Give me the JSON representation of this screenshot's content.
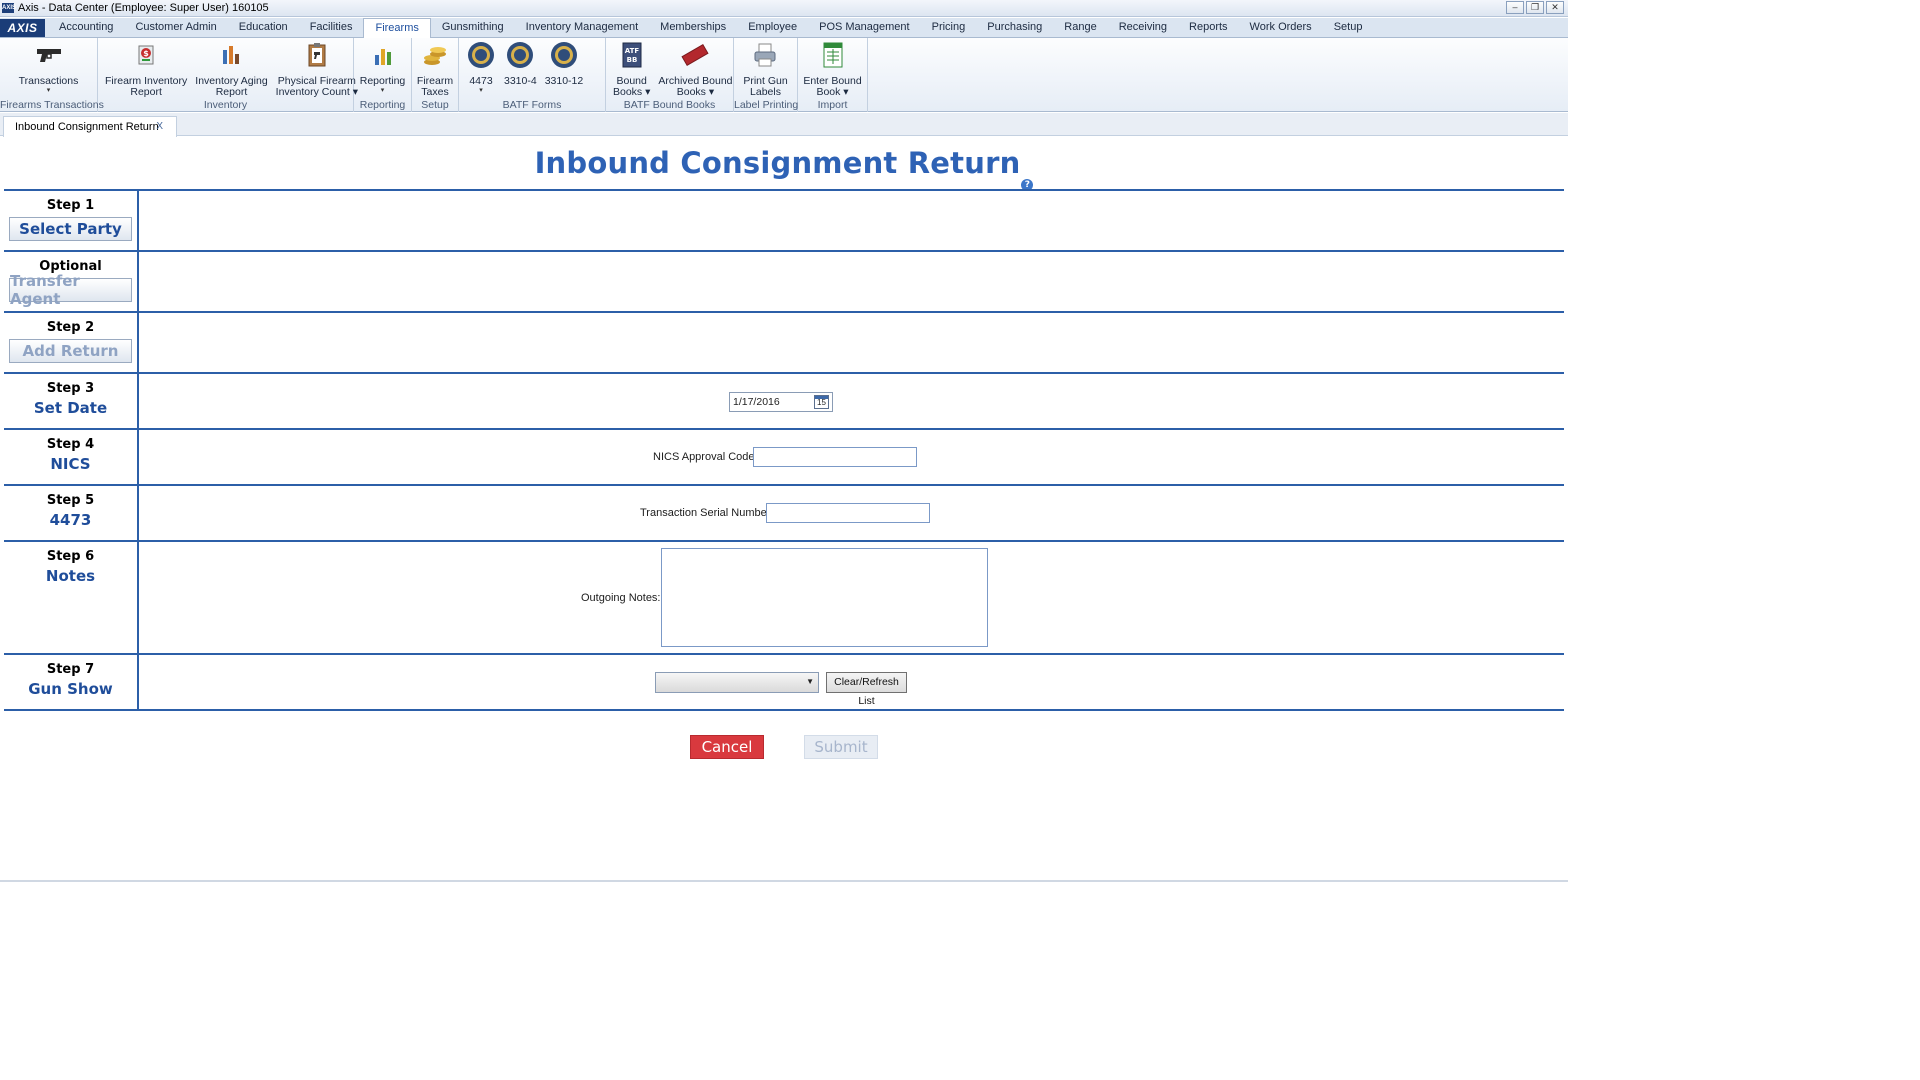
{
  "window": {
    "title": "Axis - Data Center  (Employee: Super User) 160105",
    "logo": "AXIS",
    "minimize": "–",
    "restore": "❐",
    "close": "✕"
  },
  "menu": {
    "logo": "AXIS",
    "tabs": [
      "Accounting",
      "Customer Admin",
      "Education",
      "Facilities",
      "Firearms",
      "Gunsmithing",
      "Inventory Management",
      "Memberships",
      "Employee",
      "POS Management",
      "Pricing",
      "Purchasing",
      "Range",
      "Receiving",
      "Reports",
      "Work Orders",
      "Setup"
    ],
    "active": "Firearms"
  },
  "ribbon": {
    "groups": [
      {
        "label": "Firearms Transactions",
        "buttons": [
          {
            "line1": "Transactions",
            "line2": "▾",
            "icon": "handgun-icon"
          }
        ]
      },
      {
        "label": "Inventory",
        "buttons": [
          {
            "line1": "Firearm Inventory",
            "line2": "Report",
            "icon": "inventory-report-icon"
          },
          {
            "line1": "Inventory Aging",
            "line2": "Report",
            "icon": "aging-report-icon"
          },
          {
            "line1": "Physical Firearm",
            "line2": "Inventory Count ▾",
            "icon": "clipboard-icon"
          }
        ]
      },
      {
        "label": "Reporting",
        "buttons": [
          {
            "line1": "Reporting",
            "line2": "▾",
            "icon": "bar-chart-icon"
          }
        ]
      },
      {
        "label": "Setup",
        "buttons": [
          {
            "line1": "Firearm",
            "line2": "Taxes",
            "icon": "coins-icon"
          }
        ]
      },
      {
        "label": "BATF Forms",
        "buttons": [
          {
            "line1": "4473",
            "line2": "▾",
            "icon": "seal-icon"
          },
          {
            "line1": "3310-4",
            "line2": "",
            "icon": "seal-icon"
          },
          {
            "line1": "3310-12",
            "line2": "",
            "icon": "seal-icon"
          }
        ]
      },
      {
        "label": "BATF Bound Books",
        "buttons": [
          {
            "line1": "Bound",
            "line2": "Books ▾",
            "icon": "bound-book-icon"
          },
          {
            "line1": "Archived Bound",
            "line2": "Books ▾",
            "icon": "archived-stamp-icon"
          }
        ]
      },
      {
        "label": "Label Printing",
        "buttons": [
          {
            "line1": "Print Gun",
            "line2": "Labels",
            "icon": "printer-icon"
          }
        ]
      },
      {
        "label": "Import",
        "buttons": [
          {
            "line1": "Enter Bound",
            "line2": "Book ▾",
            "icon": "spreadsheet-icon"
          }
        ]
      }
    ]
  },
  "doctab": {
    "label": "Inbound Consignment Return",
    "close": "X"
  },
  "page": {
    "title": "Inbound Consignment Return",
    "help": "?"
  },
  "steps": {
    "s1": {
      "no": "Step 1",
      "button": "Select Party"
    },
    "opt": {
      "no": "Optional",
      "button": "Transfer Agent"
    },
    "s2": {
      "no": "Step 2",
      "button": "Add Return"
    },
    "s3": {
      "no": "Step 3",
      "name": "Set Date",
      "date_value": "1/17/2016",
      "cal_day": "15"
    },
    "s4": {
      "no": "Step 4",
      "name": "NICS",
      "label": "NICS Approval Code:",
      "value": ""
    },
    "s5": {
      "no": "Step 5",
      "name": "4473",
      "label": "Transaction Serial Number:",
      "value": ""
    },
    "s6": {
      "no": "Step 6",
      "name": "Notes",
      "label": "Outgoing Notes:",
      "value": ""
    },
    "s7": {
      "no": "Step 7",
      "name": "Gun Show",
      "dropdown_value": "",
      "refresh_label": "Clear/Refresh List"
    }
  },
  "actions": {
    "cancel": "Cancel",
    "submit": "Submit"
  },
  "colors": {
    "accent": "#2e62b5",
    "rule": "#2c5fa8",
    "cancel": "#d9393e",
    "disabled": "#a7b5cc"
  }
}
